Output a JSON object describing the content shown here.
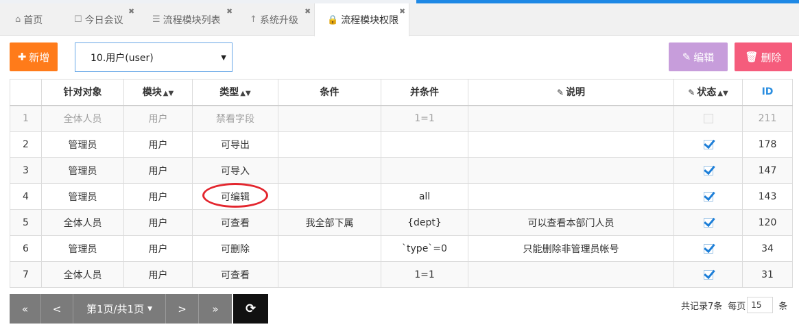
{
  "tabs": [
    {
      "label": "首页",
      "icon": "home-icon",
      "closable": false
    },
    {
      "label": "今日会议",
      "icon": "bookmark-icon",
      "closable": true
    },
    {
      "label": "流程模块列表",
      "icon": "list-icon",
      "closable": true
    },
    {
      "label": "系统升级",
      "icon": "arrow-up-icon",
      "closable": true
    },
    {
      "label": "流程模块权限",
      "icon": "lock-icon",
      "closable": true,
      "active": true
    }
  ],
  "toolbar": {
    "add_label": "新增",
    "edit_label": "编辑",
    "delete_label": "删除",
    "module_select_value": "10.用户(user)"
  },
  "columns": {
    "target": "针对对象",
    "module": "模块",
    "type": "类型",
    "condition": "条件",
    "and_condition": "并条件",
    "description": "说明",
    "status": "状态",
    "id": "ID"
  },
  "rows": [
    {
      "num": "1",
      "target": "全体人员",
      "module": "用户",
      "type": "禁看字段",
      "condition": "",
      "and_condition": "1=1",
      "description": "",
      "status": false,
      "disabled": true,
      "id": "211"
    },
    {
      "num": "2",
      "target": "管理员",
      "module": "用户",
      "type": "可导出",
      "condition": "",
      "and_condition": "",
      "description": "",
      "status": true,
      "id": "178"
    },
    {
      "num": "3",
      "target": "管理员",
      "module": "用户",
      "type": "可导入",
      "condition": "",
      "and_condition": "",
      "description": "",
      "status": true,
      "id": "147"
    },
    {
      "num": "4",
      "target": "管理员",
      "module": "用户",
      "type": "可编辑",
      "condition": "",
      "and_condition": "all",
      "description": "",
      "status": true,
      "id": "143",
      "highlighted": true
    },
    {
      "num": "5",
      "target": "全体人员",
      "module": "用户",
      "type": "可查看",
      "condition": "我全部下属",
      "and_condition": "{dept}",
      "description": "可以查看本部门人员",
      "status": true,
      "id": "120"
    },
    {
      "num": "6",
      "target": "管理员",
      "module": "用户",
      "type": "可删除",
      "condition": "",
      "and_condition": "`type`=0",
      "description": "只能删除非管理员帐号",
      "status": true,
      "id": "34"
    },
    {
      "num": "7",
      "target": "全体人员",
      "module": "用户",
      "type": "可查看",
      "condition": "",
      "and_condition": "1=1",
      "description": "",
      "status": true,
      "id": "31"
    }
  ],
  "pager": {
    "first": "«",
    "prev": "<",
    "page_label": "第1页/共1页",
    "next": ">",
    "last": "»"
  },
  "footer": {
    "total_label": "共记录7条",
    "per_page_label": "每页",
    "page_size": "15",
    "unit_label": "条"
  },
  "colors": {
    "add": "#ff7b1a",
    "edit": "#c79ddb",
    "delete": "#f55c7c",
    "highlight_ring": "#e3262e",
    "check": "#1e7fd8"
  }
}
